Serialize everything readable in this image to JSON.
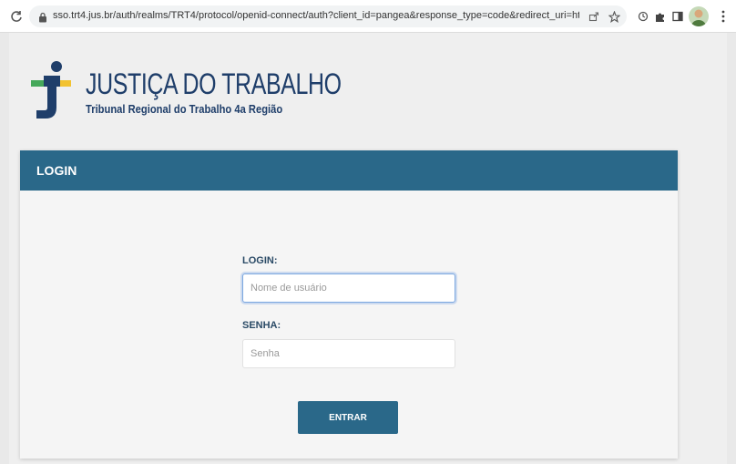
{
  "browser": {
    "url": "sso.trt4.jus.br/auth/realms/TRT4/protocol/openid-connect/auth?client_id=pangea&response_type=code&redirect_uri=http..."
  },
  "brand": {
    "title": "JUSTIÇA DO TRABALHO",
    "subtitle": "Tribunal Regional do Trabalho 4a Região",
    "colors": {
      "navy": "#1f3e6a",
      "green": "#45a85a",
      "yellow": "#f2c230"
    }
  },
  "login_card": {
    "header_title": "LOGIN",
    "header_color": "#2a6889",
    "username_label": "LOGIN:",
    "username_placeholder": "Nome de usuário",
    "password_label": "SENHA:",
    "password_placeholder": "Senha",
    "submit_label": "ENTRAR"
  },
  "icons": [
    "reload-icon",
    "lock-icon",
    "share-icon",
    "star-icon",
    "extension-icon",
    "puzzle-icon",
    "side-panel-icon",
    "avatar",
    "menu-icon"
  ]
}
